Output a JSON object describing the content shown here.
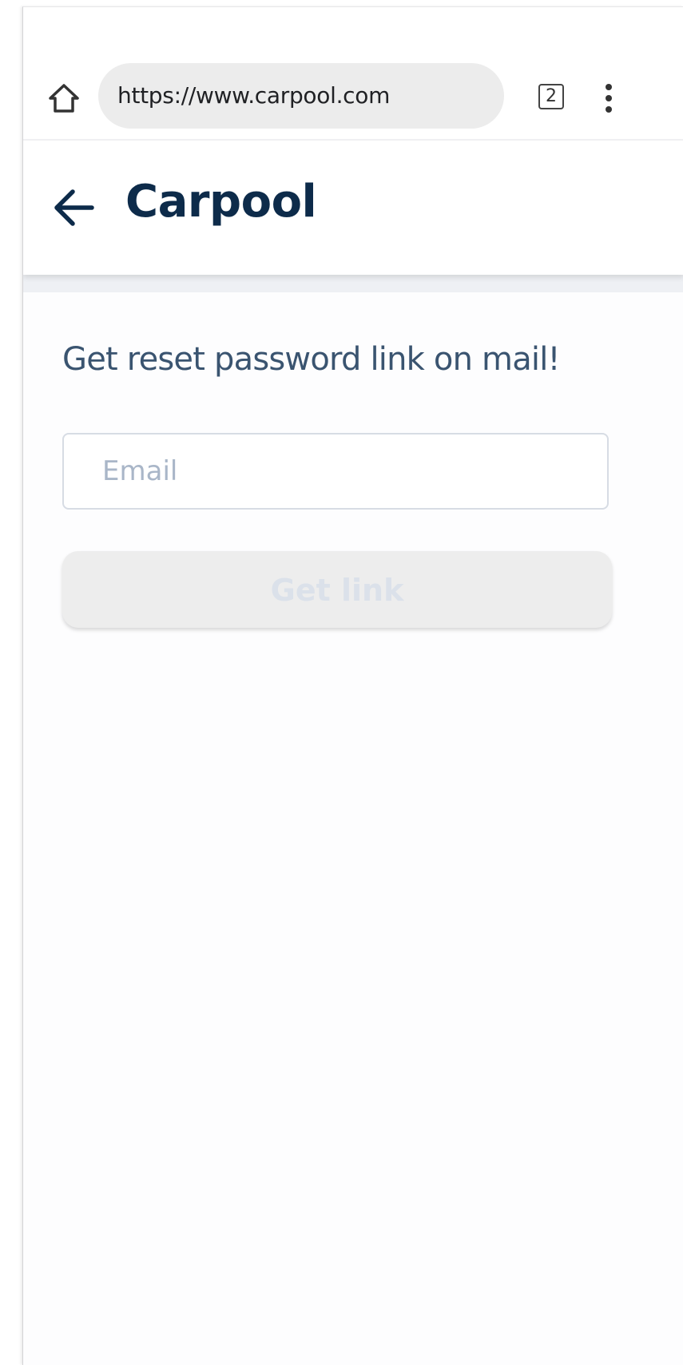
{
  "browser": {
    "url": "https://www.carpool.com",
    "tab_count": "2",
    "icons": {
      "home": "home-icon",
      "more": "more-vertical-icon"
    }
  },
  "header": {
    "title": "Carpool",
    "back_icon": "arrow-left-icon"
  },
  "form": {
    "instruction": "Get reset password link on mail!",
    "email_placeholder": "Email",
    "email_value": "",
    "submit_label": "Get link"
  },
  "colors": {
    "title": "#0d2b4a",
    "instruction": "#3a5470",
    "button_bg_disabled": "#ededed",
    "button_text_disabled": "#dbe1ea"
  }
}
